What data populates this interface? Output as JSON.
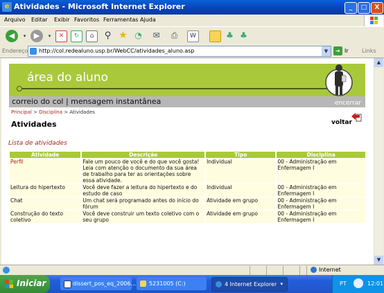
{
  "window": {
    "title": "Atividades - Microsoft Internet Explorer"
  },
  "menu": [
    "Arquivo",
    "Editar",
    "Exibir",
    "Favoritos",
    "Ferramentas",
    "Ajuda"
  ],
  "address": {
    "label": "Endereço",
    "url": "http://col.redealuno.usp.br/WebCC/atividades_aluno.asp",
    "go_label": "Ir",
    "links_label": "Links"
  },
  "banner": {
    "logo_text": "área do aluno",
    "nav_text": "correio do col  |  mensagem instantânea",
    "encerrar": "encerrar"
  },
  "breadcrumb": {
    "principal": "Principal",
    "sep": ">",
    "disciplina": "Disciplina",
    "atividades": "Atividades"
  },
  "page": {
    "title": "Atividades",
    "voltar": "voltar",
    "list_label": "Lista de atividades"
  },
  "table": {
    "headers": [
      "Atividade",
      "Descrição",
      "Tipo",
      "Disciplina"
    ],
    "rows": [
      {
        "atividade": "Perfil",
        "descricao": "Fale um pouco de você e do que você gosta! Leia com atenção o documento da sua área de trabalho para ter as orientações sobre essa atividade.",
        "tipo": "Individual",
        "disciplina": "00 - Administração em Enfermagem I"
      },
      {
        "atividade": "Leitura do hipertexto",
        "descricao": "Você deve fazer a leitura do hipertexto e do estudo de caso",
        "tipo": "Individual",
        "disciplina": "00 - Administração em Enfermagem I"
      },
      {
        "atividade": "Chat",
        "descricao": "Um chat será programado antes do início do fórum",
        "tipo": "Atividade em grupo",
        "disciplina": "00 - Administração em Enfermagem I"
      },
      {
        "atividade": "Construção do texto coletivo",
        "descricao": "Você deve construir um texto coletivo com o seu grupo",
        "tipo": "Atividade em grupo",
        "disciplina": "00 - Administração em Enfermagem I"
      }
    ]
  },
  "status": {
    "zone": "Internet"
  },
  "taskbar": {
    "start": "Iniciar",
    "tasks": [
      "dissert_pos_eq_2006...",
      "5231005 (C:)",
      "4 Internet Explorer"
    ],
    "lang": "PT",
    "time": "12:01"
  },
  "colors": {
    "accent_green": "#a9c93b",
    "link_red": "#a7241b",
    "row_bg": "#fffde0",
    "banner_gray": "#b7b7b7"
  },
  "icons": [
    "ie-icon",
    "back-icon",
    "forward-icon",
    "stop-icon",
    "refresh-icon",
    "home-icon",
    "search-icon",
    "favorites-icon",
    "history-icon",
    "mail-icon",
    "print-icon",
    "edit-icon",
    "folder-icon",
    "messenger-icon",
    "go-icon",
    "voltar-icon",
    "internet-zone-icon",
    "windows-flag-icon"
  ]
}
